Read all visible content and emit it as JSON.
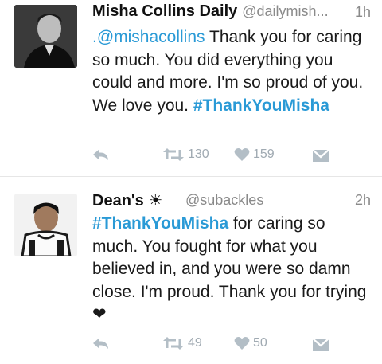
{
  "tweets": [
    {
      "name": "Misha Collins Daily",
      "handle": "@dailymish...",
      "time": "1h",
      "mention": ".@mishacollins",
      "body": " Thank you for caring so much. You did everything you could and more. I'm so proud of you. We love you. ",
      "hashtag": "#ThankYouMisha",
      "retweets": "130",
      "likes": "159"
    },
    {
      "name": "Dean's",
      "name_emoji": "☀",
      "handle": "@subackles",
      "time": "2h",
      "hashtag": "#ThankYouMisha",
      "body": " for caring so much. You fought for what you believed in, and you were so damn close. I'm proud. Thank you for trying ",
      "emoji": "❤",
      "retweets": "49",
      "likes": "50"
    }
  ],
  "icons": {
    "reply": "reply-icon",
    "retweet": "retweet-icon",
    "like": "heart-icon",
    "dm": "direct-message-icon"
  },
  "colors": {
    "link": "#2a9ad6",
    "action_gray": "#aab6be",
    "divider": "#e6e6e6"
  }
}
